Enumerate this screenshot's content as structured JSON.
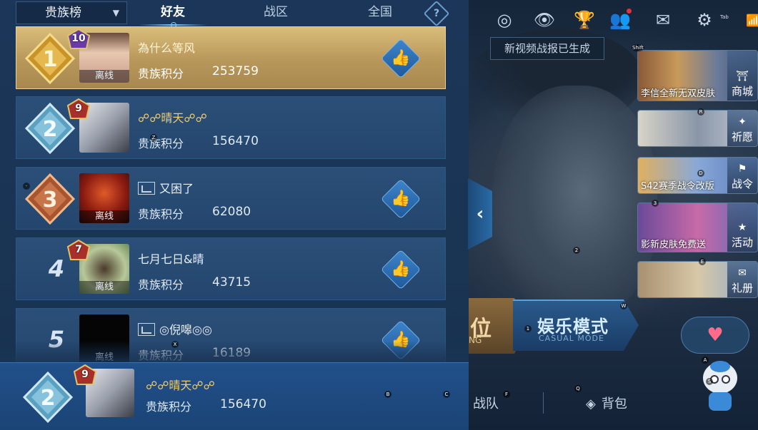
{
  "leaderboard": {
    "scope_label": "贵族榜",
    "tabs": [
      {
        "label": "好友",
        "active": true
      },
      {
        "label": "战区",
        "active": false
      },
      {
        "label": "全国",
        "active": false
      }
    ],
    "help_label": "?",
    "score_label": "贵族积分",
    "offline_label": "离线",
    "rows": [
      {
        "rank": "1",
        "level": "10",
        "name": "為什么等风",
        "score": "253759",
        "like": "👍",
        "offline": true
      },
      {
        "rank": "2",
        "level": "9",
        "name": "☍☍晴天☍☍",
        "score": "156470",
        "like": "",
        "offline": false
      },
      {
        "rank": "3",
        "level": "",
        "name": "又困了",
        "score": "62080",
        "like": "👍",
        "offline": true
      },
      {
        "rank": "4",
        "level": "7",
        "name": "七月七日&晴",
        "score": "43715",
        "like": "👍",
        "offline": true
      },
      {
        "rank": "5",
        "level": "",
        "name": "◎倪嗥◎◎",
        "score": "16189",
        "like": "👍",
        "offline": true
      }
    ],
    "me": {
      "rank": "2",
      "level": "9",
      "name": "☍☍晴天☍☍",
      "score": "156470"
    }
  },
  "game": {
    "tooltip": "新视频战报已生成",
    "mode_left_text": "位",
    "mode_left_sub": "NG",
    "casual_mode": "娱乐模式",
    "casual_mode_en": "CASUAL MODE",
    "team_label": "战队",
    "bag_label": "背包",
    "collapse_glyph": "‹",
    "heart_glyph": "♥",
    "settings_key": "Tab",
    "promos": [
      {
        "caption": "李信全新无双皮肤",
        "side_label": "商城"
      },
      {
        "caption": "",
        "side_label": "祈愿"
      },
      {
        "caption": "S42赛季战令改版",
        "side_label": "战令"
      },
      {
        "caption": "影新皮肤免费送",
        "side_label": "活动"
      },
      {
        "caption": "",
        "side_label": "礼册"
      }
    ]
  },
  "colors": {
    "panel_bg": "#1b3658",
    "first_row_gold": "#d9bd7a",
    "row_blue": "#2b4f78",
    "gold_name": "#f1cc6a",
    "accent": "#7cc8ff"
  }
}
